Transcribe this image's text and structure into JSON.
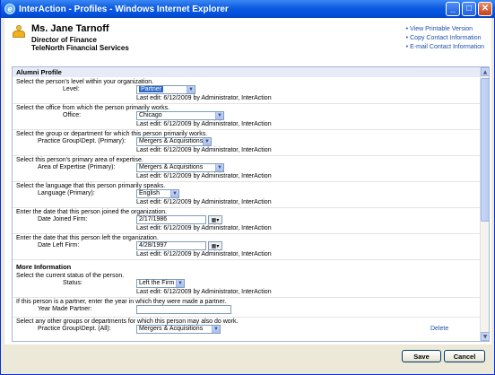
{
  "window": {
    "title": "InterAction - Profiles - Windows Internet Explorer"
  },
  "header": {
    "name": "Ms. Jane Tarnoff",
    "job_title": "Director of Finance",
    "company": "TeleNorth Financial Services",
    "links": [
      "View Printable Version",
      "Copy Contact Information",
      "E-mail Contact Information"
    ]
  },
  "alumni": {
    "section_title": "Alumni Profile",
    "fields": [
      {
        "prompt": "Select the person's level within your organization.",
        "label": "Level:",
        "value": "Partner",
        "last_edit": "Last edit: 6/12/2009 by Administrator, InterAction"
      },
      {
        "prompt": "Select the office from which the person primarily works.",
        "label": "Office:",
        "value": "Chicago",
        "last_edit": "Last edit: 6/12/2009 by Administrator, InterAction"
      },
      {
        "prompt": "Select the group or department for which this person primarily works.",
        "label": "Practice Group\\Dept. (Primary):",
        "value": "Mergers & Acquisitions",
        "last_edit": "Last edit: 6/12/2009 by Administrator, InterAction"
      },
      {
        "prompt": "Select this person's primary area of expertise.",
        "label": "Area of Expertise (Primary):",
        "value": "Mergers & Acquisitions",
        "last_edit": "Last edit: 6/12/2009 by Administrator, InterAction"
      },
      {
        "prompt": "Select the language that this person primarily speaks.",
        "label": "Language (Primary):",
        "value": "English",
        "last_edit": "Last edit: 6/12/2009 by Administrator, InterAction"
      },
      {
        "prompt": "Enter the date that this person joined the organization.",
        "label": "Date Joined Firm:",
        "value": "2/17/1986",
        "last_edit": "Last edit: 6/12/2009 by Administrator, InterAction"
      },
      {
        "prompt": "Enter the date that this person left the organization.",
        "label": "Date Left Firm:",
        "value": "4/28/1997",
        "last_edit": "Last edit: 6/12/2009 by Administrator, InterAction"
      }
    ]
  },
  "more": {
    "section_title": "More Information",
    "status": {
      "prompt": "Select the current status of the person.",
      "label": "Status:",
      "value": "Left the Firm",
      "last_edit": "Last edit: 6/12/2009 by Administrator, InterAction"
    },
    "year_partner": {
      "prompt": "If this person is a partner, enter the year in which they were made a partner.",
      "label": "Year Made Partner:",
      "value": ""
    },
    "other_groups": {
      "prompt": "Select any other groups or departments for which this person may also do work.",
      "label": "Practice Group\\Dept. (All):",
      "value": "Mergers & Acquisitions",
      "delete_label": "Delete"
    }
  },
  "buttons": {
    "save": "Save",
    "cancel": "Cancel"
  },
  "colors": {
    "titlebar": "#0554e3",
    "section_bg": "#e6ebf7",
    "link": "#1f4ea8",
    "selection": "#316ac5"
  }
}
